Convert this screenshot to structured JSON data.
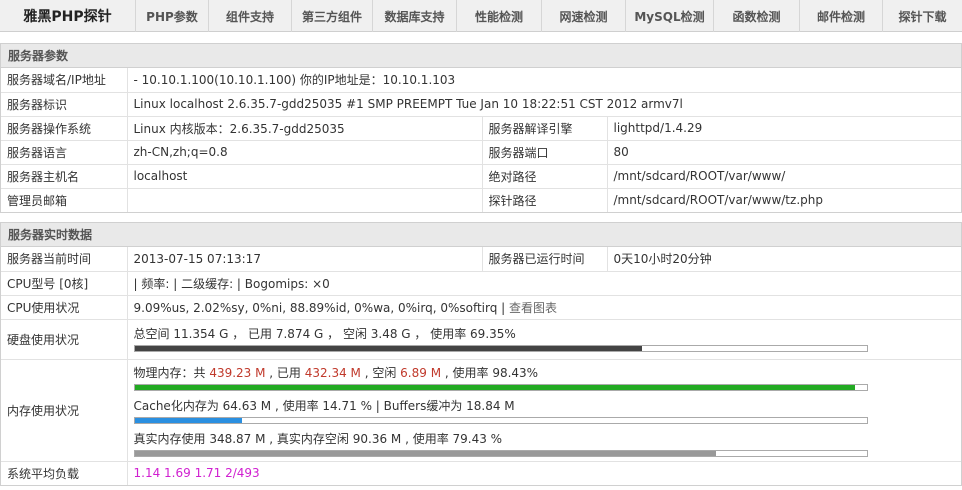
{
  "nav": {
    "brand": "雅黑PHP探针",
    "items": [
      "PHP参数",
      "组件支持",
      "第三方组件",
      "数据库支持",
      "性能检测",
      "网速检测",
      "MySQL检测",
      "函数检测",
      "邮件检测",
      "探针下载"
    ]
  },
  "server_params": {
    "header": "服务器参数",
    "domain_label": "服务器域名/IP地址",
    "domain_value": "- 10.10.1.100(10.10.1.100)  你的IP地址是：10.10.1.103",
    "ident_label": "服务器标识",
    "ident_value": "Linux localhost 2.6.35.7-gdd25035 #1 SMP PREEMPT Tue Jan 10 18:22:51 CST 2012 armv7l",
    "os_label": "服务器操作系统",
    "os_value": "Linux  内核版本：2.6.35.7-gdd25035",
    "engine_label": "服务器解译引擎",
    "engine_value": "lighttpd/1.4.29",
    "lang_label": "服务器语言",
    "lang_value": "zh-CN,zh;q=0.8",
    "port_label": "服务器端口",
    "port_value": "80",
    "host_label": "服务器主机名",
    "host_value": "localhost",
    "abspath_label": "绝对路径",
    "abspath_value": "/mnt/sdcard/ROOT/var/www/",
    "email_label": "管理员邮箱",
    "email_value": "",
    "probe_label": "探针路径",
    "probe_value": "/mnt/sdcard/ROOT/var/www/tz.php"
  },
  "realtime": {
    "header": "服务器实时数据",
    "time_label": "服务器当前时间",
    "time_value": "2013-07-15 07:13:17",
    "uptime_label": "服务器已运行时间",
    "uptime_value": "0天10小时20分钟",
    "cpu_model_label": "CPU型号 [0核]",
    "cpu_model_value": " | 频率: | 二级缓存: | Bogomips: ×0",
    "cpu_usage_label": "CPU使用状况",
    "cpu_usage_value": "9.09%us, 2.02%sy, 0%ni, 88.89%id, 0%wa, 0%irq, 0%softirq | ",
    "cpu_chart_link": "查看图表",
    "disk_label": "硬盘使用状况",
    "disk_value": "总空间 11.354 G ， 已用 7.874 G ， 空闲 3.48 G ， 使用率 69.35%",
    "disk_pct": 69.35,
    "mem_label": "内存使用状况",
    "phys_prefix": "物理内存：共 ",
    "phys_total": "439.23 M",
    "phys_used_prefix": " , 已用 ",
    "phys_used": "432.34 M",
    "phys_free_prefix": " , 空闲 ",
    "phys_free": "6.89 M",
    "phys_rate": " , 使用率 98.43%",
    "phys_pct": 98.43,
    "cache_value": "Cache化内存为 64.63 M , 使用率 14.71 % | Buffers缓冲为 18.84 M",
    "cache_pct": 14.71,
    "real_value": "真实内存使用 348.87 M , 真实内存空闲 90.36 M , 使用率 79.43 %",
    "real_pct": 79.43,
    "load_label": "系统平均负载",
    "load_value": "1.14 1.69 1.71 2/493"
  },
  "colors": {
    "disk_bar": "#444444",
    "phys_bar": "#22aa22",
    "cache_bar": "#2a8fe0",
    "real_bar": "#999999",
    "load_text": "#d020d0",
    "highlight": "#c0392b"
  }
}
